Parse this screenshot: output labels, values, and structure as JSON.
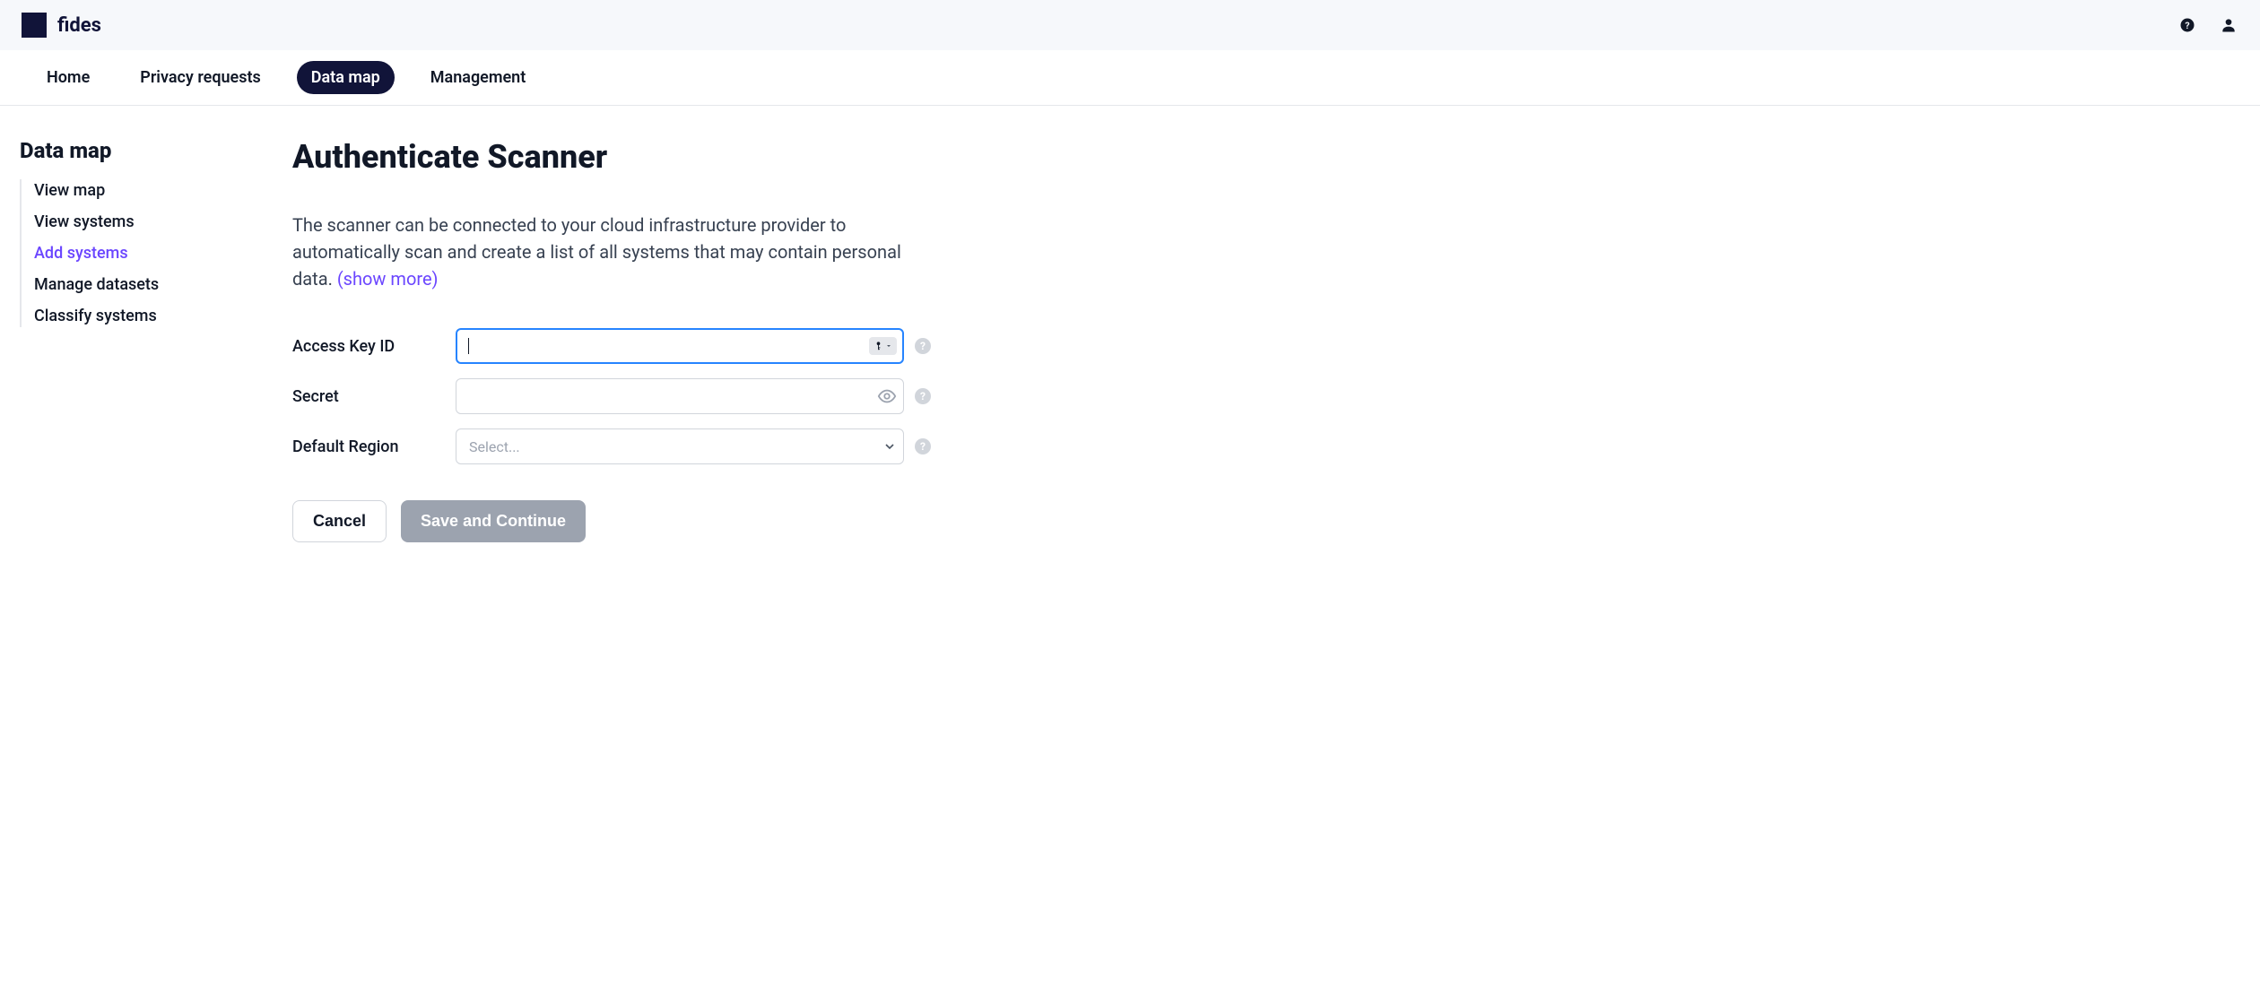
{
  "brand": {
    "name": "fides"
  },
  "nav": {
    "items": [
      {
        "label": "Home",
        "active": false
      },
      {
        "label": "Privacy requests",
        "active": false
      },
      {
        "label": "Data map",
        "active": true
      },
      {
        "label": "Management",
        "active": false
      }
    ]
  },
  "sidebar": {
    "title": "Data map",
    "items": [
      {
        "label": "View map",
        "active": false
      },
      {
        "label": "View systems",
        "active": false
      },
      {
        "label": "Add systems",
        "active": true
      },
      {
        "label": "Manage datasets",
        "active": false
      },
      {
        "label": "Classify systems",
        "active": false
      }
    ]
  },
  "page": {
    "title": "Authenticate Scanner",
    "description": "The scanner can be connected to your cloud infrastructure provider to automatically scan and create a list of all systems that may contain personal data. ",
    "show_more": "(show more)"
  },
  "form": {
    "access_key": {
      "label": "Access Key ID",
      "value": ""
    },
    "secret": {
      "label": "Secret",
      "value": ""
    },
    "region": {
      "label": "Default Region",
      "placeholder": "Select..."
    }
  },
  "actions": {
    "cancel": "Cancel",
    "save": "Save and Continue"
  }
}
